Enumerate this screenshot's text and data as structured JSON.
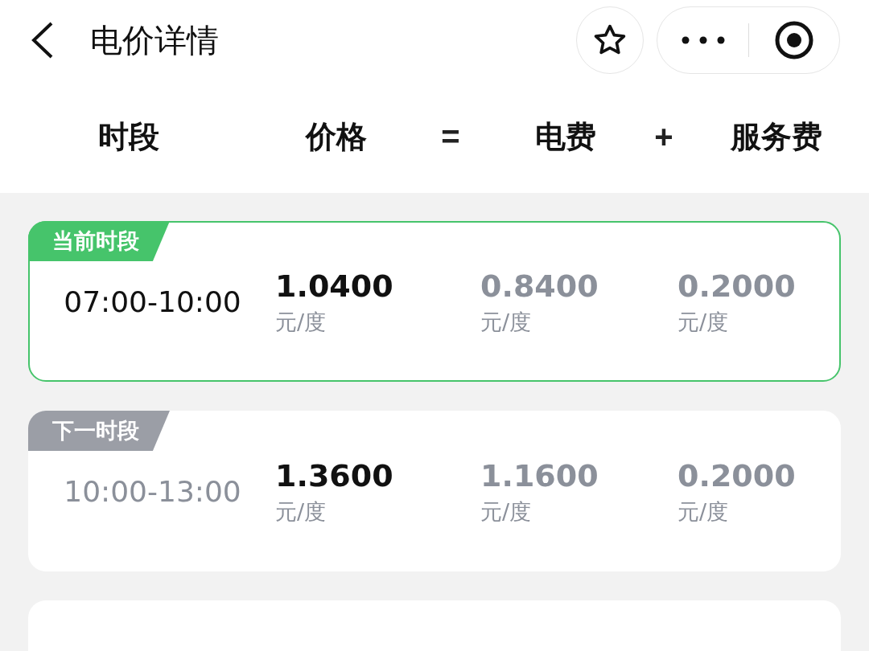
{
  "nav": {
    "title": "电价详情"
  },
  "header": [
    {
      "kind": "label",
      "text": "时段"
    },
    {
      "kind": "label",
      "text": "价格"
    },
    {
      "kind": "operator",
      "text": "="
    },
    {
      "kind": "label",
      "text": "电费"
    },
    {
      "kind": "operator",
      "text": "+"
    },
    {
      "kind": "label",
      "text": "服务费"
    }
  ],
  "periods": [
    {
      "badge": "当前时段",
      "current": true,
      "time": "07:00-10:00",
      "price": {
        "value": "1.0400",
        "unit": "元/度"
      },
      "electricity": {
        "value": "0.8400",
        "unit": "元/度"
      },
      "service": {
        "value": "0.2000",
        "unit": "元/度"
      }
    },
    {
      "badge": "下一时段",
      "current": false,
      "time": "10:00-13:00",
      "price": {
        "value": "1.3600",
        "unit": "元/度"
      },
      "electricity": {
        "value": "1.1600",
        "unit": "元/度"
      },
      "service": {
        "value": "0.2000",
        "unit": "元/度"
      }
    }
  ]
}
